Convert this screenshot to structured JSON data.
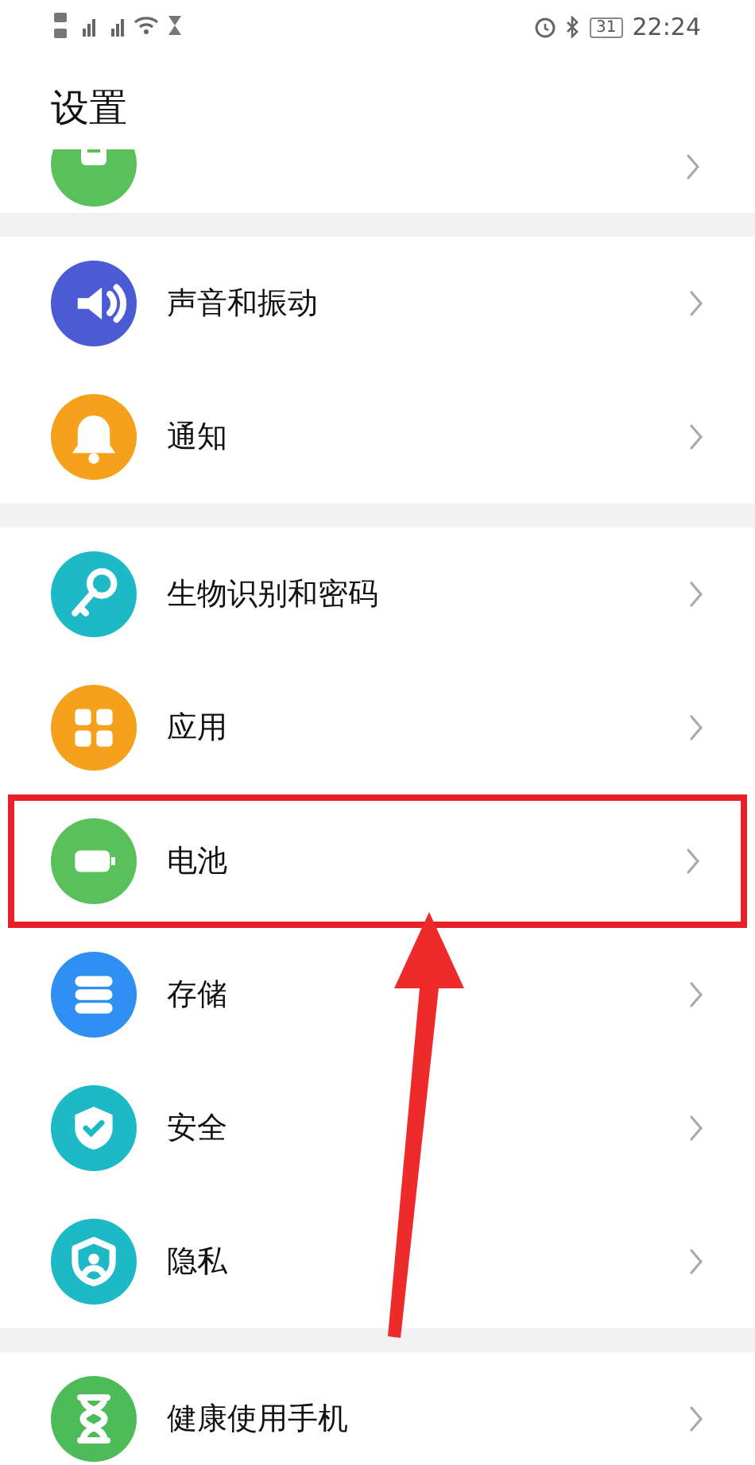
{
  "status_bar": {
    "battery": "31",
    "time": "22:24"
  },
  "title": "设置",
  "groups": [
    {
      "rows": [
        {
          "kind": "display",
          "partial": true
        }
      ]
    },
    {
      "rows": [
        {
          "kind": "sound",
          "label": "声音和振动",
          "color": "#4a5bd4"
        },
        {
          "kind": "bell",
          "label": "通知",
          "color": "#f5a11c"
        }
      ]
    },
    {
      "rows": [
        {
          "kind": "key",
          "label": "生物识别和密码",
          "color": "#1db9c6"
        },
        {
          "kind": "apps",
          "label": "应用",
          "color": "#f5a11c"
        },
        {
          "kind": "battery",
          "label": "电池",
          "color": "#5ac05a",
          "highlighted": true
        },
        {
          "kind": "storage",
          "label": "存储",
          "color": "#2f8ff2"
        },
        {
          "kind": "shield",
          "label": "安全",
          "color": "#1db9c6"
        },
        {
          "kind": "privacy",
          "label": "隐私",
          "color": "#1db9c6"
        }
      ]
    },
    {
      "rows": [
        {
          "kind": "hourglass",
          "label": "健康使用手机",
          "color": "#4cbb58"
        }
      ]
    }
  ],
  "annotation": {
    "arrow": true
  }
}
